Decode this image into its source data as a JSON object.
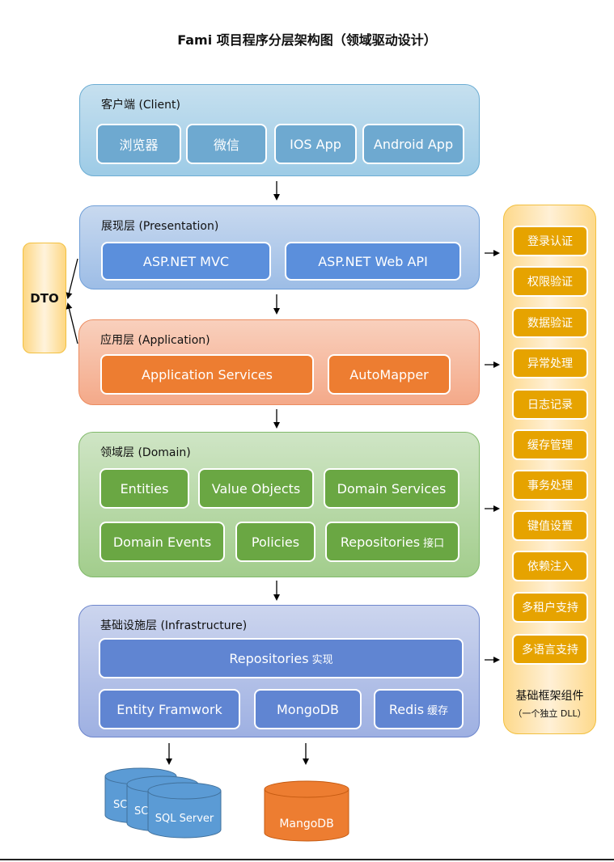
{
  "title": "Fami 项目程序分层架构图（领域驱动设计）",
  "layers": {
    "client": {
      "label": "客户端 (Client)",
      "items": [
        "浏览器",
        "微信",
        "IOS App",
        "Android App"
      ]
    },
    "presentation": {
      "label": "展现层 (Presentation)",
      "items": [
        "ASP.NET MVC",
        "ASP.NET Web API"
      ]
    },
    "application": {
      "label": "应用层 (Application)",
      "items": [
        "Application Services",
        "AutoMapper"
      ]
    },
    "domain": {
      "label": "领域层 (Domain)",
      "items": [
        "Entities",
        "Value Objects",
        "Domain Services",
        "Domain Events",
        "Policies",
        "Repositories"
      ],
      "repositories_suffix": "接口"
    },
    "infrastructure": {
      "label": "基础设施层 (Infrastructure)",
      "repositories": "Repositories",
      "repositories_suffix": "实现",
      "items": [
        "Entity Framwork",
        "MongoDB",
        "Redis"
      ],
      "redis_suffix": "缓存"
    }
  },
  "dto": {
    "label": "DTO"
  },
  "framework": {
    "items": [
      "登录认证",
      "权限验证",
      "数据验证",
      "异常处理",
      "日志记录",
      "缓存管理",
      "事务处理",
      "键值设置",
      "依赖注入",
      "多租户支持",
      "多语言支持"
    ],
    "title": "基础框架组件",
    "subtitle": "（一个独立 DLL）"
  },
  "databases": {
    "sql_stack": [
      "SQL Server",
      "SQL Server",
      "SQL Server"
    ],
    "sql_visible_partial": "SC",
    "mongo": "MangoDB"
  },
  "colors": {
    "client": "#6ea9d0",
    "presentation": "#5b8fdc",
    "application": "#ed7d31",
    "domain": "#6aa743",
    "infrastructure": "#6085d2",
    "framework": "#e6a300",
    "sql_db": "#5b9bd5",
    "mongo_db": "#ed7d31"
  }
}
